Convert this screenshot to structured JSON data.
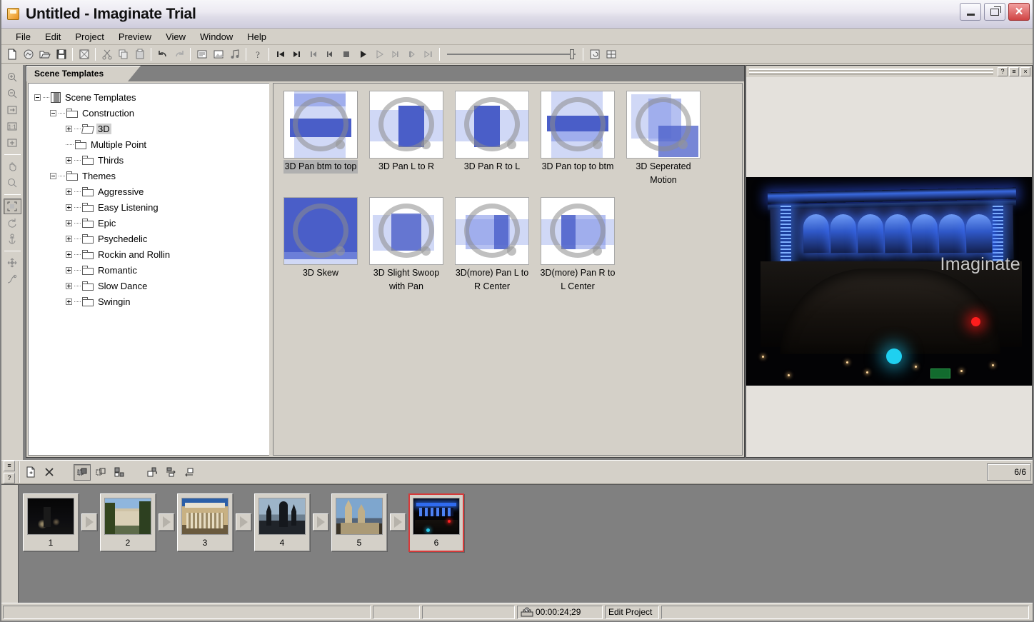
{
  "window": {
    "title": "Untitled - Imaginate Trial",
    "app_icon": "app-icon",
    "minimize": "minimize-button",
    "maximize": "maximize-button",
    "close": "close-button"
  },
  "menubar": {
    "items": [
      {
        "label": "File"
      },
      {
        "label": "Edit"
      },
      {
        "label": "Project"
      },
      {
        "label": "Preview"
      },
      {
        "label": "View"
      },
      {
        "label": "Window"
      },
      {
        "label": "Help"
      }
    ]
  },
  "toolbar": {
    "buttons": [
      {
        "name": "new-icon",
        "title": "New"
      },
      {
        "name": "open-project-icon",
        "title": "Open Project"
      },
      {
        "name": "open-folder-icon",
        "title": "Open"
      },
      {
        "name": "save-icon",
        "title": "Save"
      },
      {
        "name": "render-icon",
        "title": "Render"
      },
      {
        "name": "cut-icon",
        "title": "Cut"
      },
      {
        "name": "copy-icon",
        "title": "Copy"
      },
      {
        "name": "paste-icon",
        "title": "Paste"
      },
      {
        "name": "undo-icon",
        "title": "Undo"
      },
      {
        "name": "redo-icon",
        "title": "Redo"
      },
      {
        "name": "properties-icon",
        "title": "Properties"
      },
      {
        "name": "add-image-icon",
        "title": "Add Image"
      },
      {
        "name": "add-music-icon",
        "title": "Add Music"
      },
      {
        "name": "help-icon",
        "title": "Help"
      }
    ],
    "transport": [
      {
        "name": "rewind-start-icon",
        "title": "Go to start"
      },
      {
        "name": "step-back-marker-icon",
        "title": "Previous marker"
      },
      {
        "name": "previous-icon",
        "title": "Previous"
      },
      {
        "name": "frame-back-icon",
        "title": "Step back"
      },
      {
        "name": "stop-icon",
        "title": "Stop"
      },
      {
        "name": "play-icon",
        "title": "Play"
      },
      {
        "name": "play-outline-icon",
        "title": "Play preview"
      },
      {
        "name": "next-icon",
        "title": "Next"
      },
      {
        "name": "step-forward-marker-icon",
        "title": "Next marker"
      },
      {
        "name": "fast-forward-end-icon",
        "title": "Go to end"
      }
    ],
    "slider_value": "",
    "right_buttons": [
      {
        "name": "preview-window-icon",
        "title": "Preview window"
      },
      {
        "name": "timeline-window-icon",
        "title": "Timeline window"
      }
    ]
  },
  "vertical_tools": [
    {
      "name": "zoom-in-icon",
      "title": "Zoom In"
    },
    {
      "name": "zoom-out-icon",
      "title": "Zoom Out"
    },
    {
      "name": "fit-to-window-icon",
      "title": "Fit to Window"
    },
    {
      "name": "actual-size-icon",
      "title": "1:1 Actual Size"
    },
    {
      "name": "center-icon",
      "title": "Center"
    },
    {
      "name": "pan-hand-icon",
      "title": "Pan"
    },
    {
      "name": "magnifier-icon",
      "title": "Magnifier"
    },
    {
      "name": "crop-icon",
      "title": "Crop"
    },
    {
      "name": "rotate-icon",
      "title": "Rotate"
    },
    {
      "name": "anchor-icon",
      "title": "Anchor"
    },
    {
      "name": "move-icon",
      "title": "Move"
    },
    {
      "name": "curve-icon",
      "title": "Curve"
    }
  ],
  "template_window": {
    "tab_label": "Scene Templates",
    "tree": [
      {
        "label": "Scene Templates",
        "depth": 0,
        "expander": "minus",
        "icon": "computer-icon",
        "selected": false
      },
      {
        "label": "Construction",
        "depth": 1,
        "expander": "minus",
        "icon": "folder-icon",
        "selected": false
      },
      {
        "label": "3D",
        "depth": 2,
        "expander": "plus",
        "icon": "folder-open-icon",
        "selected": true
      },
      {
        "label": "Multiple Point",
        "depth": 2,
        "expander": "none",
        "icon": "folder-icon",
        "selected": false
      },
      {
        "label": "Thirds",
        "depth": 2,
        "expander": "plus",
        "icon": "folder-icon",
        "selected": false
      },
      {
        "label": "Themes",
        "depth": 1,
        "expander": "minus",
        "icon": "folder-icon",
        "selected": false
      },
      {
        "label": "Aggressive",
        "depth": 2,
        "expander": "plus",
        "icon": "folder-icon",
        "selected": false
      },
      {
        "label": "Easy Listening",
        "depth": 2,
        "expander": "plus",
        "icon": "folder-icon",
        "selected": false
      },
      {
        "label": "Epic",
        "depth": 2,
        "expander": "plus",
        "icon": "folder-icon",
        "selected": false
      },
      {
        "label": "Psychedelic",
        "depth": 2,
        "expander": "plus",
        "icon": "folder-icon",
        "selected": false
      },
      {
        "label": "Rockin and Rollin",
        "depth": 2,
        "expander": "plus",
        "icon": "folder-icon",
        "selected": false
      },
      {
        "label": "Romantic",
        "depth": 2,
        "expander": "plus",
        "icon": "folder-icon",
        "selected": false
      },
      {
        "label": "Slow Dance",
        "depth": 2,
        "expander": "plus",
        "icon": "folder-icon",
        "selected": false
      },
      {
        "label": "Swingin",
        "depth": 2,
        "expander": "plus",
        "icon": "folder-icon",
        "selected": false
      }
    ],
    "templates": [
      {
        "label": "3D Pan  btm to top",
        "selected": true,
        "art": "pan-btm-top"
      },
      {
        "label": "3D Pan L to R",
        "selected": false,
        "art": "pan-l-r"
      },
      {
        "label": "3D Pan R to L",
        "selected": false,
        "art": "pan-r-l"
      },
      {
        "label": "3D Pan top to btm",
        "selected": false,
        "art": "pan-top-btm"
      },
      {
        "label": "3D Seperated Motion",
        "selected": false,
        "art": "separated"
      },
      {
        "label": "3D Skew",
        "selected": false,
        "art": "skew"
      },
      {
        "label": "3D Slight Swoop with Pan",
        "selected": false,
        "art": "swoop"
      },
      {
        "label": "3D(more) Pan L to R Center",
        "selected": false,
        "art": "more-l-r"
      },
      {
        "label": "3D(more) Pan R to L Center",
        "selected": false,
        "art": "more-r-l"
      }
    ]
  },
  "preview_window": {
    "help_button": "?",
    "menu_button": "≡",
    "close_button": "×",
    "watermark": "Imaginate"
  },
  "timeline": {
    "side_buttons": [
      {
        "name": "list-menu-icon",
        "label": "≡"
      },
      {
        "name": "timeline-help-icon",
        "label": "?"
      }
    ],
    "buttons": [
      {
        "name": "add-slide-icon",
        "title": "Add Slide",
        "pressed": false
      },
      {
        "name": "delete-slide-icon",
        "title": "Delete Slide",
        "pressed": false
      },
      {
        "name": "slide-view-icon",
        "title": "Slide View",
        "pressed": true
      },
      {
        "name": "transition-view-icon",
        "title": "Transition View",
        "pressed": false
      },
      {
        "name": "grouped-view-icon",
        "title": "Grouped View",
        "pressed": false
      },
      {
        "name": "insert-before-icon",
        "title": "Insert Before",
        "pressed": false
      },
      {
        "name": "swap-icon",
        "title": "Swap Slides",
        "pressed": false
      },
      {
        "name": "move-back-icon",
        "title": "Move Back",
        "pressed": false
      }
    ],
    "counter": "6/6",
    "frames": [
      {
        "number": "1",
        "art": "night-monument",
        "selected": false
      },
      {
        "number": "2",
        "art": "daylight-pavilion",
        "selected": false
      },
      {
        "number": "3",
        "art": "columns-building",
        "selected": false
      },
      {
        "number": "4",
        "art": "cathedral-dusk",
        "selected": false
      },
      {
        "number": "5",
        "art": "cathedral-towers",
        "selected": false
      },
      {
        "number": "6",
        "art": "blue-lit-building",
        "selected": true
      }
    ]
  },
  "statusbar": {
    "message": "",
    "pane2": "",
    "pane3": "",
    "timecode": "00:00:24;29",
    "mode": "Edit Project",
    "clock_icon": "timecode-icon"
  },
  "colors": {
    "selection_red": "#d63a3a",
    "template_blue": "#4a5ec8",
    "chrome": "#d4d0c8",
    "workspace": "#808080"
  }
}
